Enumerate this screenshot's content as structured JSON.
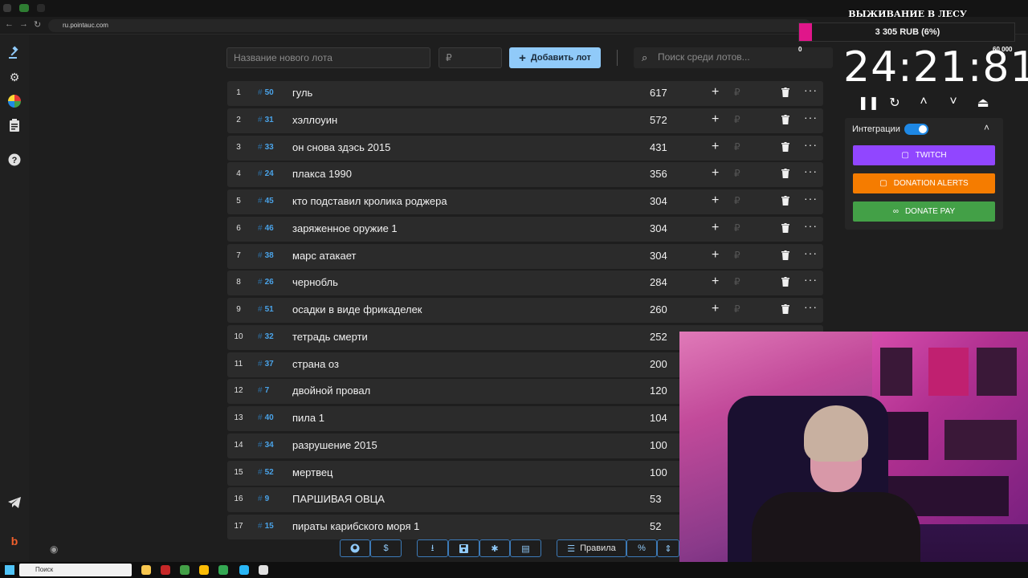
{
  "browser": {
    "url": "ru.pointauc.com"
  },
  "sidebar": {
    "items": [
      {
        "icon": "auction-hammer-icon"
      },
      {
        "icon": "gear-icon"
      },
      {
        "icon": "wheel-icon"
      },
      {
        "icon": "clipboard-icon"
      },
      {
        "icon": "help-icon"
      },
      {
        "icon": "telegram-icon"
      },
      {
        "icon": "boosty-icon"
      },
      {
        "icon": "eye-icon"
      }
    ]
  },
  "toolbar": {
    "lot_name_placeholder": "Название нового лота",
    "amount_placeholder": "₽",
    "add_button_label": "Добавить лот",
    "search_placeholder": "Поиск среди лотов..."
  },
  "lots": [
    {
      "index": "1",
      "fast_id": "50",
      "name": "гуль",
      "amount": "617"
    },
    {
      "index": "2",
      "fast_id": "31",
      "name": "хэллоуин",
      "amount": "572"
    },
    {
      "index": "3",
      "fast_id": "33",
      "name": "он снова здэсь 2015",
      "amount": "431"
    },
    {
      "index": "4",
      "fast_id": "24",
      "name": "плакса 1990",
      "amount": "356"
    },
    {
      "index": "5",
      "fast_id": "45",
      "name": "кто подставил кролика роджера",
      "amount": "304"
    },
    {
      "index": "6",
      "fast_id": "46",
      "name": "заряженное оружие 1",
      "amount": "304"
    },
    {
      "index": "7",
      "fast_id": "38",
      "name": "марс атакает",
      "amount": "304"
    },
    {
      "index": "8",
      "fast_id": "26",
      "name": "чернобль",
      "amount": "284"
    },
    {
      "index": "9",
      "fast_id": "51",
      "name": "осадки в виде фрикаделек",
      "amount": "260"
    },
    {
      "index": "10",
      "fast_id": "32",
      "name": "тетрадь смерти",
      "amount": "252"
    },
    {
      "index": "11",
      "fast_id": "37",
      "name": "страна оз",
      "amount": "200"
    },
    {
      "index": "12",
      "fast_id": "7",
      "name": " двойной провал",
      "amount": "120"
    },
    {
      "index": "13",
      "fast_id": "40",
      "name": "пила 1",
      "amount": "104"
    },
    {
      "index": "14",
      "fast_id": "34",
      "name": "разрушение 2015",
      "amount": "100"
    },
    {
      "index": "15",
      "fast_id": "52",
      "name": "мертвец",
      "amount": "100"
    },
    {
      "index": "16",
      "fast_id": "9",
      "name": "ПАРШИВАЯ ОВЦА",
      "amount": "53"
    },
    {
      "index": "17",
      "fast_id": "15",
      "name": "пираты карибского моря 1",
      "amount": "52"
    }
  ],
  "row_actions": {
    "plus": "+",
    "rub": "₽",
    "more": "···"
  },
  "bottom_bar": {
    "rules_label": "Правила",
    "percent_label": "%"
  },
  "overlay": {
    "title": "ВЫЖИВАНИЕ В ЛЕСУ",
    "goal_text": "3 305 RUB (6%)",
    "goal_progress": 0.06,
    "goal_min": "0",
    "goal_max": "60 000",
    "timer": "24:21:81"
  },
  "integrations": {
    "label": "Интеграции",
    "enabled": true,
    "twitch_label": "TWITCH",
    "donation_alerts_label": "DONATION ALERTS",
    "donatepay_label": "DONATE PAY"
  },
  "taskbar": {
    "search_label": "Поиск"
  },
  "colors": {
    "accent": "#90caf9",
    "twitch": "#9146ff",
    "donation_alerts": "#f57c00",
    "donatepay": "#43a047",
    "goal_fill": "#e0168a"
  }
}
